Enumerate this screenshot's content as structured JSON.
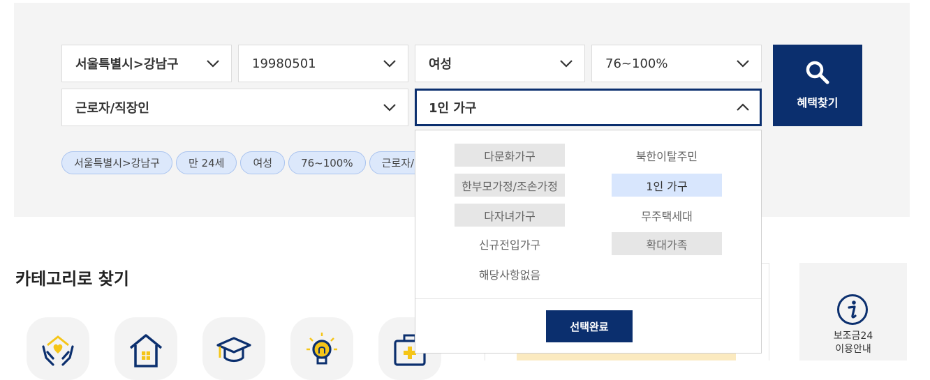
{
  "filters": {
    "region": "서울특별시>강남구",
    "birth_date": "19980501",
    "gender": "여성",
    "income": "76~100%",
    "occupation": "근로자/직장인",
    "household": "1인 가구"
  },
  "search_button": {
    "label": "혜택찾기",
    "icon": "search-icon"
  },
  "chips": [
    "서울특별시>강남구",
    "만 24세",
    "여성",
    "76~100%",
    "근로자/직장인"
  ],
  "household_dropdown": {
    "options": [
      {
        "label": "다문화가구",
        "state": "gray"
      },
      {
        "label": "북한이탈주민",
        "state": "plain"
      },
      {
        "label": "한부모가정/조손가정",
        "state": "gray"
      },
      {
        "label": "1인 가구",
        "state": "selected"
      },
      {
        "label": "다자녀가구",
        "state": "gray"
      },
      {
        "label": "무주택세대",
        "state": "plain"
      },
      {
        "label": "신규전입가구",
        "state": "plain"
      },
      {
        "label": "확대가족",
        "state": "gray"
      },
      {
        "label": "해당사항없음",
        "state": "plain"
      }
    ],
    "confirm_label": "선택완료"
  },
  "category": {
    "title": "카테고리로 찾기",
    "icons": [
      "hands-heart-icon",
      "house-icon",
      "graduation-cap-icon",
      "lightbulb-icon",
      "medical-kit-icon"
    ]
  },
  "guide": {
    "line1": "보조금24",
    "line2": "이용안내",
    "icon": "info-icon"
  },
  "colors": {
    "primary": "#0b2f6e",
    "chip_bg": "#dce8fb",
    "selected_bg": "#d8e6fd",
    "panel_bg": "#f4f4f4",
    "accent_yellow": "#f5c518"
  }
}
